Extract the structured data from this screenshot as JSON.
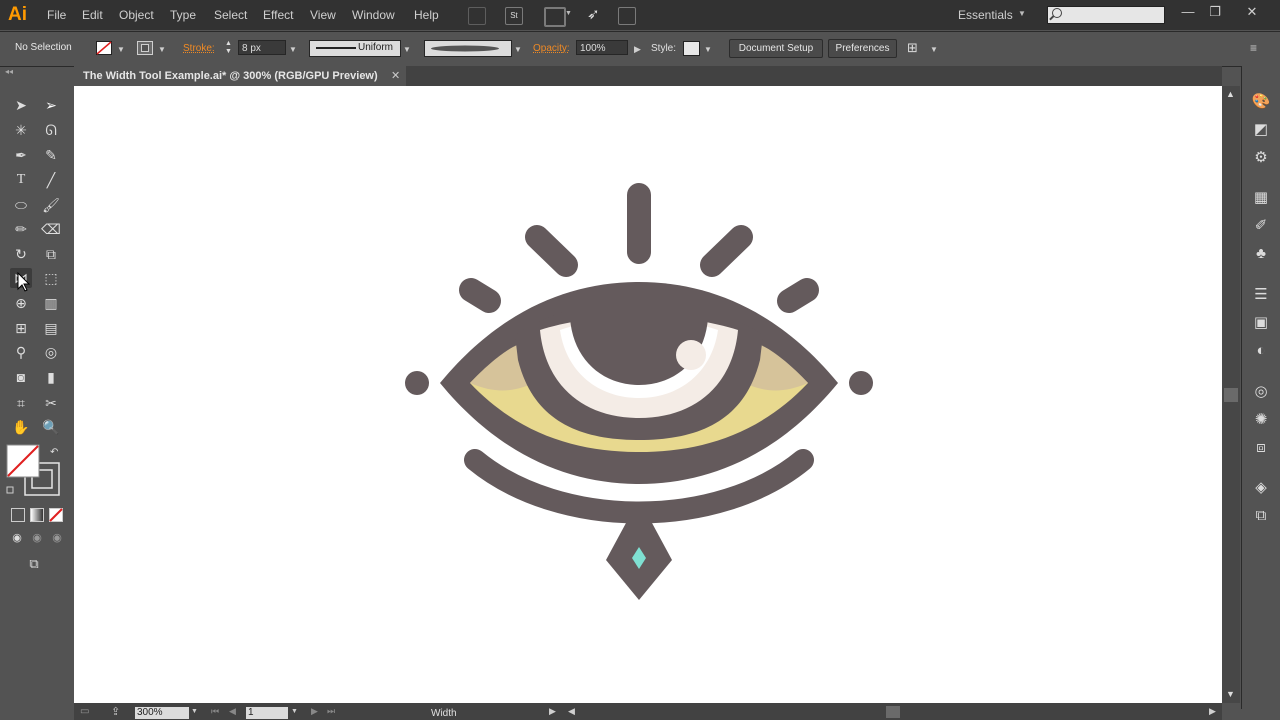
{
  "app": {
    "logo": "Ai"
  },
  "menu": [
    "File",
    "Edit",
    "Object",
    "Type",
    "Select",
    "Effect",
    "View",
    "Window",
    "Help"
  ],
  "toolbar_icons": [
    "bridge-icon",
    "stock-icon",
    "arrange-documents-icon",
    "gpu-performance-icon",
    "cloud-sync-icon"
  ],
  "workspace": {
    "label": "Essentials"
  },
  "window_controls": {
    "minimize": "—",
    "restore": "❐",
    "close": "✕"
  },
  "control_bar": {
    "selection": "No Selection",
    "stroke_label": "Stroke:",
    "stroke_weight": "8 px",
    "profile": "Uniform",
    "opacity_label": "Opacity:",
    "opacity": "100%",
    "style_label": "Style:",
    "document_setup": "Document Setup",
    "preferences": "Preferences"
  },
  "document": {
    "tab_title": "The Width Tool Example.ai* @ 300% (RGB/GPU Preview)",
    "close": "✕"
  },
  "status_bar": {
    "zoom": "300%",
    "artboard": "1",
    "tool": "Width"
  },
  "colors": {
    "eye_stroke": "#645a5c",
    "iris_fill": "#e8d98f",
    "iris_shade": "#d6c39a",
    "gem": "#7fe0d2",
    "highlight": "#f4ece6",
    "accent": "#ff9a00"
  }
}
